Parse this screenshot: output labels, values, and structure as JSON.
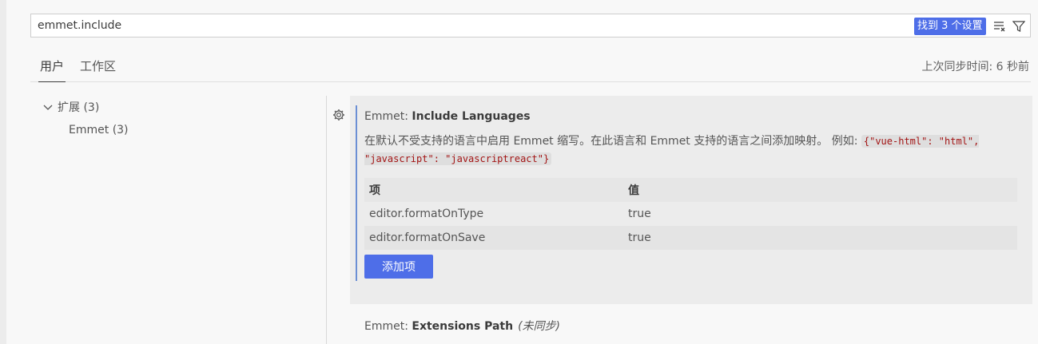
{
  "search": {
    "value": "emmet.include",
    "result_badge": "找到 3 个设置"
  },
  "tabs": [
    {
      "label": "用户"
    },
    {
      "label": "工作区"
    }
  ],
  "sync_status": "上次同步时间: 6 秒前",
  "tree": {
    "group": {
      "label": "扩展",
      "count": "(3)"
    },
    "child": {
      "label": "Emmet",
      "count": "(3)"
    }
  },
  "setting1": {
    "category": "Emmet: ",
    "name": "Include Languages",
    "description": "在默认不受支持的语言中启用 Emmet 缩写。在此语言和 Emmet 支持的语言之间添加映射。 例如: ",
    "example": "{\"vue-html\": \"html\", \"javascript\": \"javascriptreact\"}",
    "table": {
      "headers": [
        "项",
        "值"
      ],
      "rows": [
        [
          "editor.formatOnType",
          "true"
        ],
        [
          "editor.formatOnSave",
          "true"
        ]
      ]
    },
    "add_button": "添加项"
  },
  "setting2": {
    "category": "Emmet: ",
    "name": "Extensions Path",
    "nosync": "(未同步)"
  },
  "colors": {
    "accent": "#4e6ee8",
    "focus": "#6b8fd4"
  },
  "icons": {
    "settings": "gear-icon",
    "clear": "clear-filter-icon",
    "filter": "filter-icon",
    "chevron": "chevron-down-icon"
  }
}
